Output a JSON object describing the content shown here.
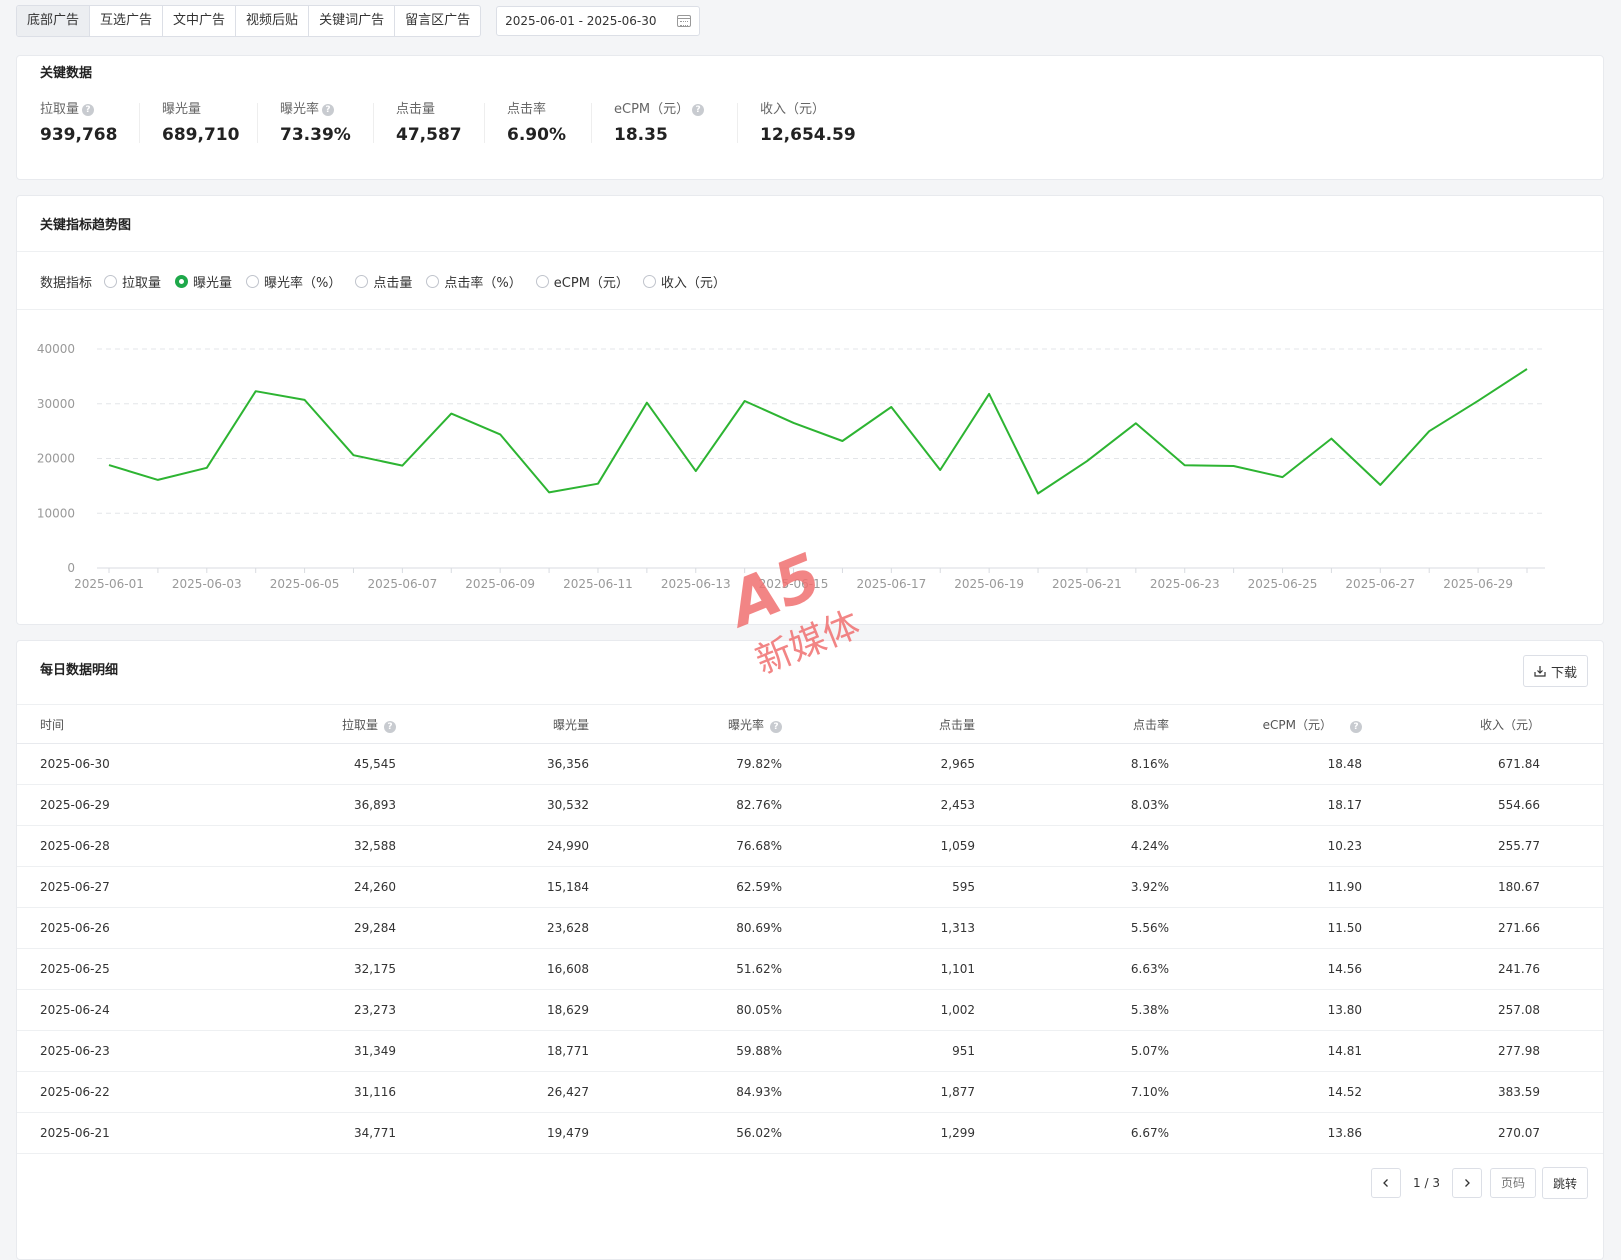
{
  "tabs": [
    "底部广告",
    "互选广告",
    "文中广告",
    "视频后贴",
    "关键词广告",
    "留言区广告"
  ],
  "date_range": "2025-06-01 - 2025-06-30",
  "key_data": {
    "title": "关键数据",
    "metrics": [
      {
        "label": "拉取量",
        "value": "939,768",
        "help": true
      },
      {
        "label": "曝光量",
        "value": "689,710",
        "help": false
      },
      {
        "label": "曝光率",
        "value": "73.39%",
        "help": true
      },
      {
        "label": "点击量",
        "value": "47,587",
        "help": false
      },
      {
        "label": "点击率",
        "value": "6.90%",
        "help": false
      },
      {
        "label": "eCPM（元）",
        "value": "18.35",
        "help": true
      },
      {
        "label": "收入（元）",
        "value": "12,654.59",
        "help": false
      }
    ]
  },
  "trend": {
    "title": "关键指标趋势图",
    "indicator_label": "数据指标",
    "options": [
      "拉取量",
      "曝光量",
      "曝光率（%）",
      "点击量",
      "点击率（%）",
      "eCPM（元）",
      "收入（元）"
    ],
    "selected": "曝光量"
  },
  "chart_data": {
    "type": "line",
    "x": [
      "2025-06-01",
      "2025-06-02",
      "2025-06-03",
      "2025-06-04",
      "2025-06-05",
      "2025-06-06",
      "2025-06-07",
      "2025-06-08",
      "2025-06-09",
      "2025-06-10",
      "2025-06-11",
      "2025-06-12",
      "2025-06-13",
      "2025-06-14",
      "2025-06-15",
      "2025-06-16",
      "2025-06-17",
      "2025-06-18",
      "2025-06-19",
      "2025-06-20",
      "2025-06-21",
      "2025-06-22",
      "2025-06-23",
      "2025-06-24",
      "2025-06-25",
      "2025-06-26",
      "2025-06-27",
      "2025-06-28",
      "2025-06-29",
      "2025-06-30"
    ],
    "x_tick_labels": [
      "2025-06-01",
      "2025-06-03",
      "2025-06-05",
      "2025-06-07",
      "2025-06-09",
      "2025-06-11",
      "2025-06-13",
      "2025-06-15",
      "2025-06-17",
      "2025-06-19",
      "2025-06-21",
      "2025-06-23",
      "2025-06-25",
      "2025-06-27",
      "2025-06-29"
    ],
    "series": [
      {
        "name": "曝光量",
        "color": "#2db432",
        "values": [
          18800,
          16100,
          18300,
          32300,
          30700,
          20600,
          18700,
          28200,
          24400,
          13800,
          15400,
          30200,
          17700,
          30500,
          26500,
          23200,
          29400,
          17900,
          31800,
          13600,
          19500,
          26427,
          18771,
          18629,
          16608,
          23628,
          15184,
          24990,
          30532,
          36356
        ]
      }
    ],
    "ylim": [
      0,
      40000
    ],
    "y_ticks": [
      0,
      10000,
      20000,
      30000,
      40000
    ],
    "grid": true
  },
  "daily": {
    "title": "每日数据明细",
    "download_label": "下载",
    "columns": [
      "时间",
      "拉取量",
      "曝光量",
      "曝光率",
      "点击量",
      "点击率",
      "eCPM（元）",
      "收入（元）"
    ],
    "rows": [
      [
        "2025-06-30",
        "45,545",
        "36,356",
        "79.82%",
        "2,965",
        "8.16%",
        "18.48",
        "671.84"
      ],
      [
        "2025-06-29",
        "36,893",
        "30,532",
        "82.76%",
        "2,453",
        "8.03%",
        "18.17",
        "554.66"
      ],
      [
        "2025-06-28",
        "32,588",
        "24,990",
        "76.68%",
        "1,059",
        "4.24%",
        "10.23",
        "255.77"
      ],
      [
        "2025-06-27",
        "24,260",
        "15,184",
        "62.59%",
        "595",
        "3.92%",
        "11.90",
        "180.67"
      ],
      [
        "2025-06-26",
        "29,284",
        "23,628",
        "80.69%",
        "1,313",
        "5.56%",
        "11.50",
        "271.66"
      ],
      [
        "2025-06-25",
        "32,175",
        "16,608",
        "51.62%",
        "1,101",
        "6.63%",
        "14.56",
        "241.76"
      ],
      [
        "2025-06-24",
        "23,273",
        "18,629",
        "80.05%",
        "1,002",
        "5.38%",
        "13.80",
        "257.08"
      ],
      [
        "2025-06-23",
        "31,349",
        "18,771",
        "59.88%",
        "951",
        "5.07%",
        "14.81",
        "277.98"
      ],
      [
        "2025-06-22",
        "31,116",
        "26,427",
        "84.93%",
        "1,877",
        "7.10%",
        "14.52",
        "383.59"
      ],
      [
        "2025-06-21",
        "34,771",
        "19,479",
        "56.02%",
        "1,299",
        "6.67%",
        "13.86",
        "270.07"
      ]
    ],
    "pagination": {
      "info": "1 / 3",
      "page_placeholder": "页码",
      "jump_label": "跳转"
    }
  },
  "watermark": {
    "logo_text": "A5",
    "text": "新媒体",
    "color": "#f07070"
  }
}
